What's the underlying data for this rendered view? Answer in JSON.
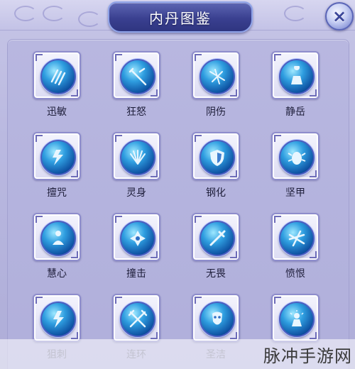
{
  "window": {
    "title": "内丹图鉴",
    "close_label": "×"
  },
  "grid": {
    "items": [
      {
        "label": "迅敏",
        "icon": "claw-slash-icon"
      },
      {
        "label": "狂怒",
        "icon": "crossed-blade-icon"
      },
      {
        "label": "阴伤",
        "icon": "dark-slash-icon"
      },
      {
        "label": "静岳",
        "icon": "mountain-figure-icon"
      },
      {
        "label": "擅咒",
        "icon": "lightning-rune-icon"
      },
      {
        "label": "灵身",
        "icon": "spirit-wings-icon"
      },
      {
        "label": "钢化",
        "icon": "shield-icon"
      },
      {
        "label": "坚甲",
        "icon": "beetle-armor-icon"
      },
      {
        "label": "慧心",
        "icon": "meditating-figure-icon"
      },
      {
        "label": "撞击",
        "icon": "impact-icon"
      },
      {
        "label": "无畏",
        "icon": "sword-strike-icon"
      },
      {
        "label": "愤恨",
        "icon": "rage-slash-icon"
      },
      {
        "label": "狙刺",
        "icon": "lightning-strike-icon"
      },
      {
        "label": "连环",
        "icon": "crossed-swords-icon"
      },
      {
        "label": "圣洁",
        "icon": "holy-mask-icon"
      },
      {
        "label": "",
        "icon": "radiant-figure-icon"
      }
    ]
  },
  "watermark": {
    "text": "脉冲手游网"
  },
  "colors": {
    "background": "#b9b8e0",
    "title_plate": "#3a4090",
    "orb": "#2f9ee0",
    "label_text": "#1e1e3a"
  }
}
